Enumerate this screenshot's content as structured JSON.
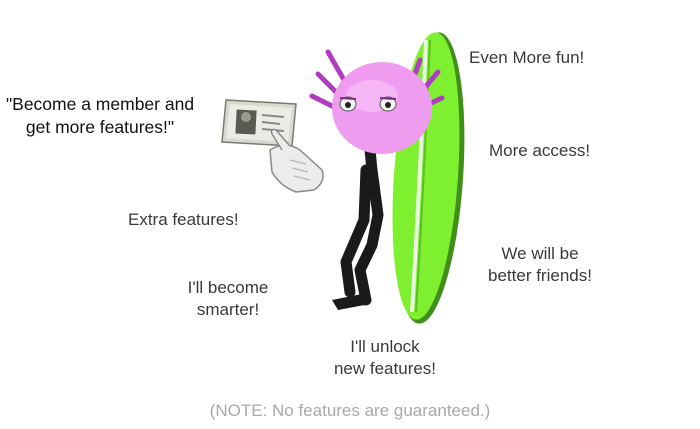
{
  "quote": {
    "line1": "\"Become a member and",
    "line2": "get more features!\""
  },
  "callouts": {
    "even_more_fun": "Even More fun!",
    "more_access": "More access!",
    "extra_features": "Extra features!",
    "better_friends_line1": "We will be",
    "better_friends_line2": "better friends!",
    "smarter_line1": "I'll become",
    "smarter_line2": "smarter!",
    "unlock_line1": "I'll unlock",
    "unlock_line2": "new features!"
  },
  "note": "(NOTE: No features are guaranteed.)",
  "colors": {
    "surfboard": "#7ef030",
    "head": "#ef9cf0",
    "spikes": "#b03cc0",
    "body": "#1a1a1a",
    "text": "#3a3a3a",
    "note": "#a9a9a9"
  },
  "icons": [
    "membership-card-icon",
    "pointing-hand-icon",
    "axolotl-mascot",
    "surfboard"
  ]
}
